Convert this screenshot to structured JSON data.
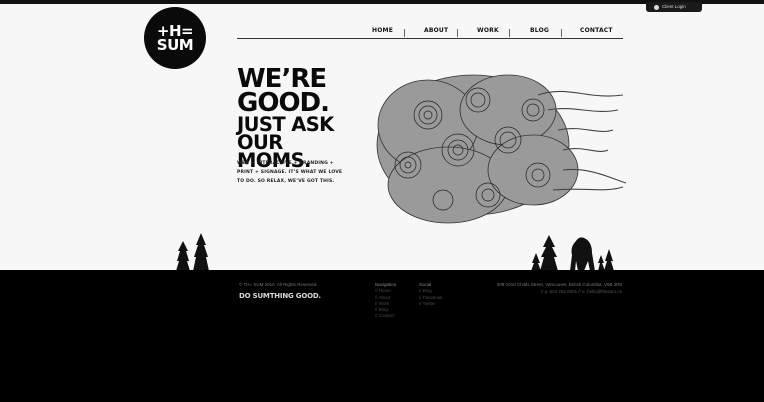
{
  "client_login": {
    "label": "Client Login"
  },
  "logo": {
    "line1": "+H=",
    "line2": "SUM"
  },
  "nav": {
    "items": [
      {
        "label": "HOME"
      },
      {
        "label": "ABOUT"
      },
      {
        "label": "WORK"
      },
      {
        "label": "BLOG"
      },
      {
        "label": "CONTACT"
      }
    ]
  },
  "hero": {
    "headline_1": "WE’RE",
    "headline_2": "GOOD.",
    "headline_3": "JUST ASK",
    "headline_4": "OUR MOMS.",
    "tagline_1": "WEB + INTERACTIVE + BRANDING +",
    "tagline_2": "PRINT + SIGNAGE. IT’S WHAT WE LOVE",
    "tagline_3": "TO DO. SO RELAX, WE’VE GOT THIS."
  },
  "footer": {
    "copyright": "© TH= SUM 2010. All Rights Reserved.",
    "slogan": "DO SUMTHING GOOD.",
    "navigation": {
      "heading": "Navigation",
      "items": [
        "// Home",
        "// About",
        "// Work",
        "// Blog",
        "// Contact"
      ]
    },
    "social": {
      "heading": "Social",
      "items": [
        "// Blog",
        "// Facebook",
        "// Twitter"
      ]
    },
    "address": "208-1010 Childs Street, Vancouver, British Columbia, V6B 2R8",
    "phone": "// p. 604.762.6001 // e. hello@thesum.ca"
  }
}
